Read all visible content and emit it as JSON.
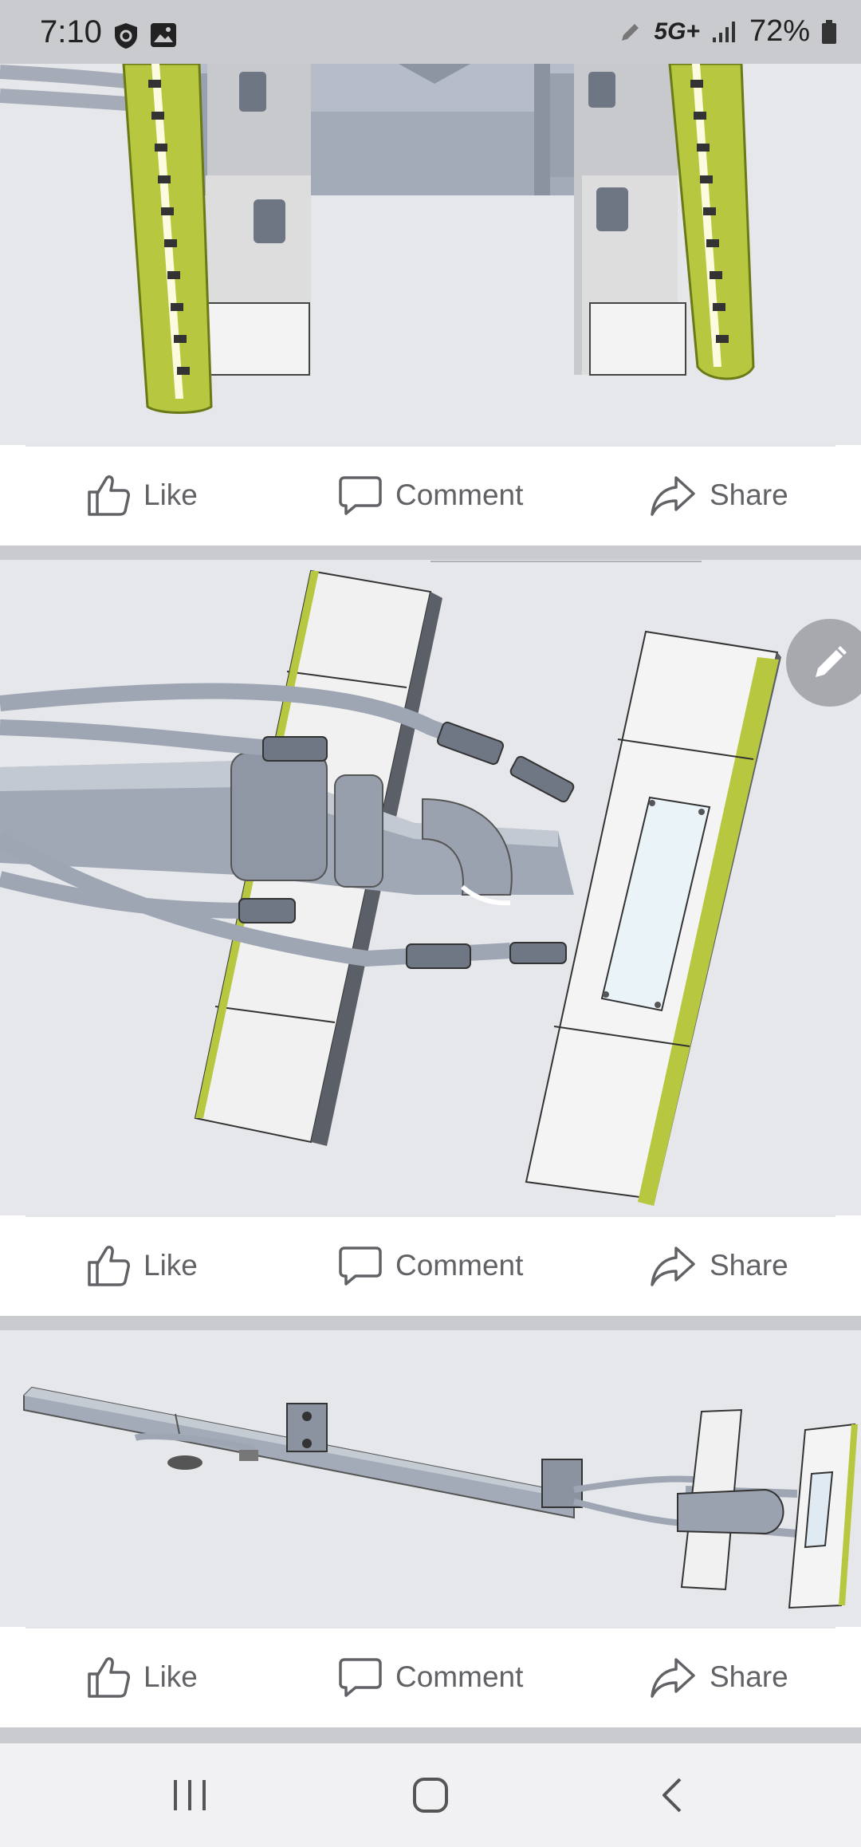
{
  "status_bar": {
    "time": "7:10",
    "network": "5G+",
    "battery": "72%",
    "icons": [
      "shield-icon",
      "image-icon",
      "pencil-icon",
      "signal-icon",
      "battery-icon"
    ]
  },
  "posts": [
    {
      "image_label": "cad-model-top-view",
      "actions": {
        "like": "Like",
        "comment": "Comment",
        "share": "Share"
      }
    },
    {
      "image_label": "cad-model-angled-view",
      "actions": {
        "like": "Like",
        "comment": "Comment",
        "share": "Share"
      }
    },
    {
      "image_label": "cad-model-full-view",
      "actions": {
        "like": "Like",
        "comment": "Comment",
        "share": "Share"
      }
    }
  ],
  "fab": {
    "icon": "pencil-icon"
  },
  "nav": {
    "icons": [
      "recent-apps-icon",
      "home-icon",
      "back-icon"
    ]
  },
  "colors": {
    "accent_green": "#b8c94a",
    "metal": "#9ba3b0",
    "background": "#e6e7eb",
    "action_text": "#606266"
  }
}
